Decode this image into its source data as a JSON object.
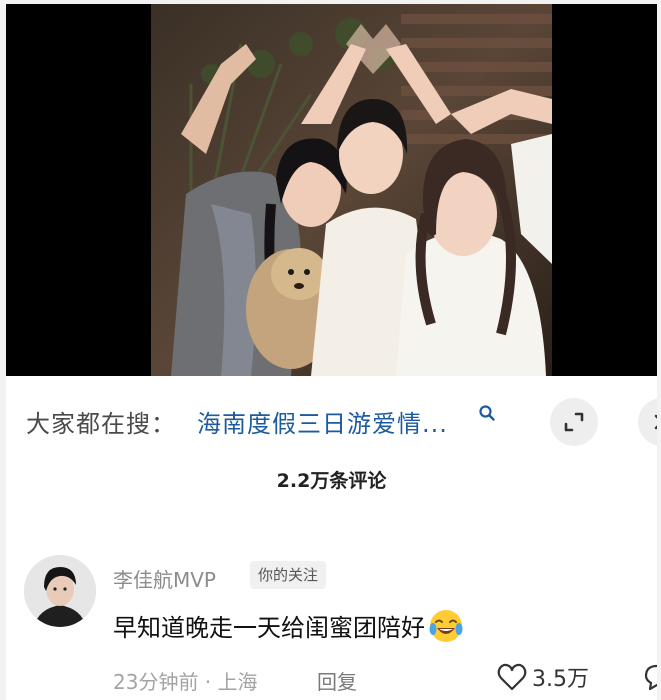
{
  "search": {
    "prefix": "大家都在搜：",
    "term": "海南度假三日游爱情..."
  },
  "comments": {
    "count_label": "2.2万条评论"
  },
  "comment": {
    "author": "李佳航MVP",
    "badge": "你的关注",
    "text": "早知道晚走一天给闺蜜团陪好",
    "emoji": "tears-of-joy-emoji",
    "time": "23分钟前 · 上海",
    "reply_label": "回复",
    "like_count": "3.5万"
  },
  "icons": {
    "search": "search-icon",
    "expand": "expand-icon",
    "close": "close-icon",
    "like": "heart-icon",
    "more": "comment-icon"
  },
  "colors": {
    "link_blue": "#1c5b9e",
    "text_dark": "#111111",
    "text_muted": "#a3a3a3",
    "background": "#ffffff"
  }
}
